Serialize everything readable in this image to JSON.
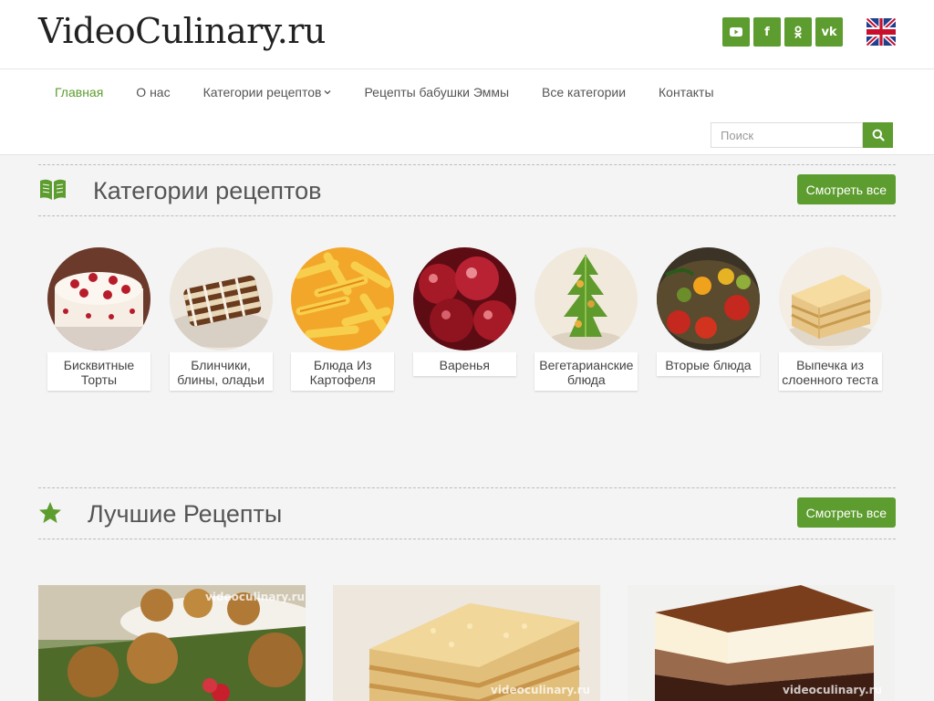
{
  "header": {
    "logo": "VideoCulinary.ru",
    "social": [
      {
        "icon": "youtube-icon",
        "glyph": "▶"
      },
      {
        "icon": "facebook-icon",
        "glyph": "f"
      },
      {
        "icon": "odnoklassniki-icon",
        "glyph": "ok"
      },
      {
        "icon": "vk-icon",
        "glyph": "vk"
      }
    ],
    "language_flag": "uk-flag-icon",
    "nav": [
      {
        "label": "Главная",
        "active": true
      },
      {
        "label": "О нас"
      },
      {
        "label": "Категории рецептов",
        "dropdown": true
      },
      {
        "label": "Рецепты бабушки Эммы"
      },
      {
        "label": "Все категории"
      },
      {
        "label": "Контакты"
      }
    ],
    "search": {
      "placeholder": "Поиск"
    }
  },
  "categories_section": {
    "title": "Категории рецептов",
    "button": "Смотреть все",
    "items": [
      {
        "label": "Бисквитные Торты"
      },
      {
        "label": "Блинчики, блины, оладьи"
      },
      {
        "label": "Блюда Из Картофеля"
      },
      {
        "label": "Варенья"
      },
      {
        "label": "Вегетарианские блюда"
      },
      {
        "label": "Вторые блюда"
      },
      {
        "label": "Выпечка из слоенного теста"
      }
    ]
  },
  "best_section": {
    "title": "Лучшие Рецепты",
    "button": "Смотреть все",
    "watermark": "videoculinary.ru"
  },
  "colors": {
    "accent": "#5d9c2e",
    "background": "#f4f4f4"
  }
}
